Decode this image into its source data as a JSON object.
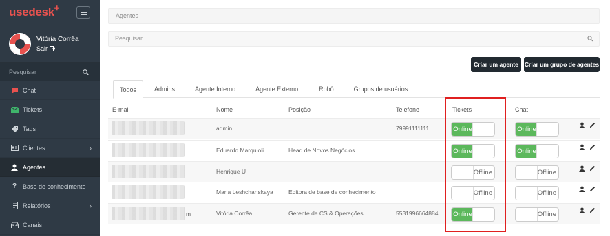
{
  "sidebar": {
    "logo": "usedesk",
    "logo_mark": "✚",
    "user": {
      "name": "Vitória Corrêa",
      "logout": "Sair"
    },
    "search_placeholder": "Pesquisar",
    "items": [
      {
        "label": "Chat",
        "icon": "chat-icon",
        "color": "#e8524f"
      },
      {
        "label": "Tickets",
        "icon": "envelope-icon",
        "color": "#3fb56b"
      },
      {
        "label": "Tags",
        "icon": "tag-icon",
        "color": "#cdd3d8"
      },
      {
        "label": "Clientes",
        "icon": "address-card-icon",
        "color": "#cdd3d8",
        "arrow": true
      },
      {
        "label": "Agentes",
        "icon": "user-icon",
        "color": "#ffffff",
        "active": true
      },
      {
        "label": "Base de conhecimento",
        "icon": "question-icon",
        "color": "#cdd3d8"
      },
      {
        "label": "Relatórios",
        "icon": "report-icon",
        "color": "#cdd3d8",
        "arrow": true
      },
      {
        "label": "Canais",
        "icon": "inbox-icon",
        "color": "#cdd3d8"
      }
    ]
  },
  "main": {
    "breadcrumb": "Agentes",
    "search_placeholder": "Pesquisar",
    "buttons": {
      "create_agent": "Criar um agente",
      "create_group": "Criar um grupo de agentes"
    },
    "tabs": [
      "Todos",
      "Admins",
      "Agente Interno",
      "Agente Externo",
      "Robô",
      "Grupos de usuários"
    ],
    "columns": {
      "email": "E-mail",
      "name": "Nome",
      "position": "Posição",
      "phone": "Telefone",
      "tickets": "Tickets",
      "chat": "Chat"
    },
    "toggle_labels": {
      "on": "Online",
      "off": "Offline"
    },
    "rows": [
      {
        "email_suffix": "",
        "name": "admin",
        "position": "",
        "phone": "79991111111",
        "tickets": true,
        "chat": true
      },
      {
        "email_suffix": "",
        "name": "Eduardo Marquioli",
        "position": "Head de Novos Negócios",
        "phone": "",
        "tickets": true,
        "chat": true
      },
      {
        "email_suffix": "",
        "name": "Henrique U",
        "position": "",
        "phone": "",
        "tickets": false,
        "chat": false
      },
      {
        "email_suffix": "",
        "name": "Maria Leshchanskaya",
        "position": "Editora de base de conhecimento",
        "phone": "",
        "tickets": false,
        "chat": false
      },
      {
        "email_suffix": "m",
        "name": "Vitória Corrêa",
        "position": "Gerente de CS & Operações",
        "phone": "5531996664884",
        "tickets": true,
        "chat": false
      }
    ]
  },
  "colors": {
    "sidebar_bg": "#2f3a45",
    "online_green": "#5cb85c",
    "highlight_red": "#e02020",
    "brand_red": "#e8524f"
  }
}
